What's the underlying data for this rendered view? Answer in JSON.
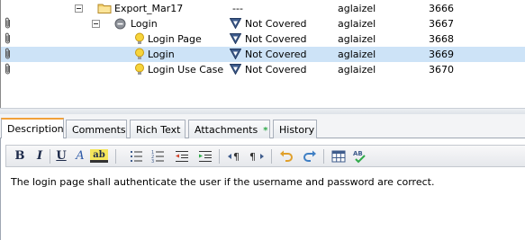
{
  "grid": {
    "rows": [
      {
        "name": "Export_Mar17",
        "status": "---",
        "owner": "aglaizel",
        "id": "3666",
        "type": "folder",
        "attached": false,
        "selected": false
      },
      {
        "name": "Login",
        "status": "Not Covered",
        "owner": "aglaizel",
        "id": "3667",
        "type": "group",
        "attached": true,
        "selected": false
      },
      {
        "name": "Login Page",
        "status": "Not Covered",
        "owner": "aglaizel",
        "id": "3668",
        "type": "requirement",
        "attached": true,
        "selected": false
      },
      {
        "name": "Login",
        "status": "Not Covered",
        "owner": "aglaizel",
        "id": "3669",
        "type": "requirement",
        "attached": true,
        "selected": true
      },
      {
        "name": "Login Use Case",
        "status": "Not Covered",
        "owner": "aglaizel",
        "id": "3670",
        "type": "requirement",
        "attached": true,
        "selected": false
      }
    ]
  },
  "tabs": [
    {
      "label": "Description",
      "active": true
    },
    {
      "label": "Comments",
      "active": false
    },
    {
      "label": "Rich Text",
      "active": false
    },
    {
      "label": "Attachments",
      "active": false,
      "badge": "*"
    },
    {
      "label": "History",
      "active": false
    }
  ],
  "toolbar": {
    "bold": "B",
    "italic": "I",
    "underline": "U",
    "font_color": "A",
    "highlight": "ab"
  },
  "editor": {
    "text": "The login page shall authenticate the user if the username and password are correct."
  },
  "colors": {
    "selection": "#cde3f7",
    "active_tab_accent": "#f1a13a",
    "attachments_badge": "#2faa4a",
    "status_icon": "#3f5c8c"
  }
}
